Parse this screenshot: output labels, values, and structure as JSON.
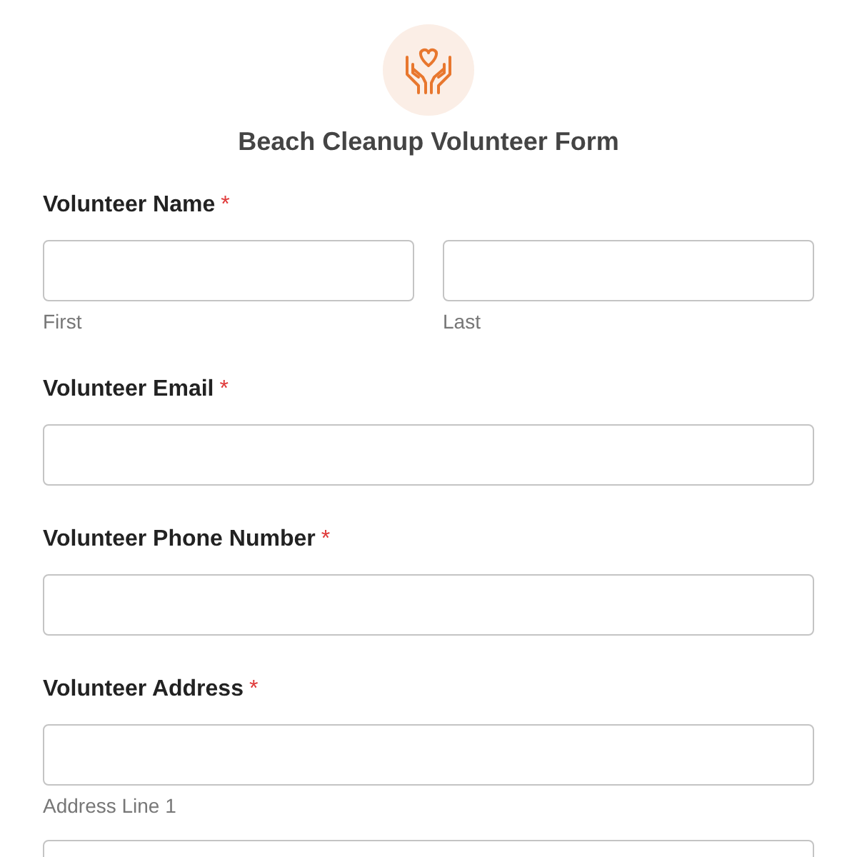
{
  "form": {
    "title": "Beach Cleanup Volunteer Form"
  },
  "fields": [
    {
      "label": "Volunteer Name",
      "required_mark": "*",
      "inputs": [
        {
          "kind": "text",
          "sublabel": "First"
        },
        {
          "kind": "text",
          "sublabel": "Last"
        }
      ]
    },
    {
      "label": "Volunteer Email",
      "required_mark": "*",
      "inputs": [
        {
          "kind": "text"
        }
      ]
    },
    {
      "label": "Volunteer Phone Number",
      "required_mark": "*",
      "inputs": [
        {
          "kind": "text"
        }
      ]
    },
    {
      "label": "Volunteer Address",
      "required_mark": "*",
      "inputs": [
        {
          "kind": "text",
          "sublabel": "Address Line 1"
        },
        {
          "kind": "text"
        }
      ]
    }
  ]
}
